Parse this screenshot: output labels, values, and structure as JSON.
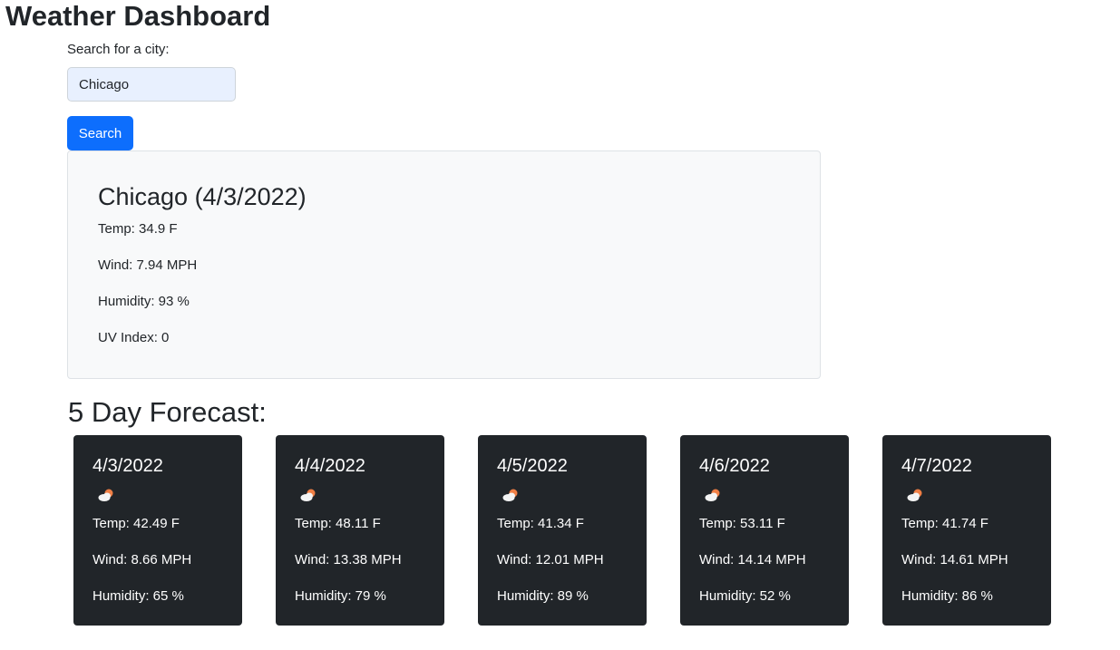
{
  "header": {
    "title": "Weather Dashboard"
  },
  "search": {
    "label": "Search for a city:",
    "value": "Chicago",
    "button_label": "Search"
  },
  "current": {
    "heading": "Chicago (4/3/2022)",
    "temp": "Temp: 34.9 F",
    "wind": "Wind: 7.94 MPH",
    "humidity": "Humidity: 93 %",
    "uv": "UV Index: 0"
  },
  "forecast": {
    "title": "5 Day Forecast:",
    "icon": "partly-cloudy-icon",
    "days": [
      {
        "date": "4/3/2022",
        "temp": "Temp: 42.49 F",
        "wind": "Wind: 8.66 MPH",
        "humidity": "Humidity: 65 %"
      },
      {
        "date": "4/4/2022",
        "temp": "Temp: 48.11 F",
        "wind": "Wind: 13.38 MPH",
        "humidity": "Humidity: 79 %"
      },
      {
        "date": "4/5/2022",
        "temp": "Temp: 41.34 F",
        "wind": "Wind: 12.01 MPH",
        "humidity": "Humidity: 89 %"
      },
      {
        "date": "4/6/2022",
        "temp": "Temp: 53.11 F",
        "wind": "Wind: 14.14 MPH",
        "humidity": "Humidity: 52 %"
      },
      {
        "date": "4/7/2022",
        "temp": "Temp: 41.74 F",
        "wind": "Wind: 14.61 MPH",
        "humidity": "Humidity: 86 %"
      }
    ]
  },
  "colors": {
    "primary": "#0d6efd",
    "card_dark": "#212529",
    "card_light": "#f8f9fa",
    "input_bg": "#e8f0fe"
  }
}
